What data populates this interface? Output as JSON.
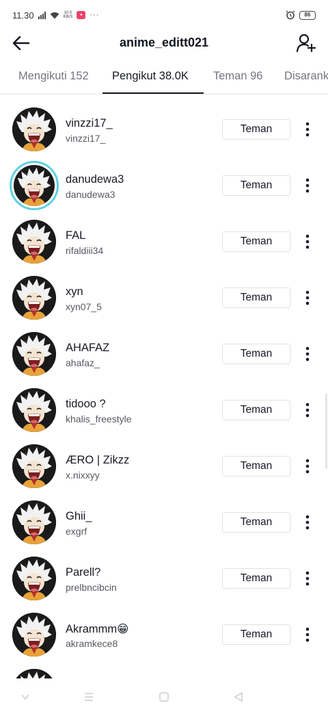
{
  "status_bar": {
    "time": "11.30",
    "net_speed_top": "10.0",
    "net_speed_bottom": "KB/S",
    "more": "···",
    "battery": "86"
  },
  "header": {
    "title": "anime_editt021",
    "back_icon": "arrow-left-icon",
    "add_icon": "add-user-icon"
  },
  "tabs": [
    {
      "label": "Mengikuti 152",
      "active": false
    },
    {
      "label": "Pengikut 38.0K",
      "active": true
    },
    {
      "label": "Teman 96",
      "active": false
    },
    {
      "label": "Disarankan",
      "active": false
    }
  ],
  "users": [
    {
      "name": "vinzzi17_",
      "username": "vinzzi17_",
      "button": "Teman",
      "story": false
    },
    {
      "name": "danudewa3",
      "username": "danudewa3",
      "button": "Teman",
      "story": true
    },
    {
      "name": "FAL",
      "username": "rifaldiii34",
      "button": "Teman",
      "story": false
    },
    {
      "name": "xyn",
      "username": "xyn07_5",
      "button": "Teman",
      "story": false
    },
    {
      "name": "AHAFAZ",
      "username": "ahafaz_",
      "button": "Teman",
      "story": false
    },
    {
      "name": "tidooo ?",
      "username": "khalis_freestyle",
      "button": "Teman",
      "story": false
    },
    {
      "name": "ÆRO | Zikzz",
      "username": "x.nixxyy",
      "button": "Teman",
      "story": false
    },
    {
      "name": "Ghii_",
      "username": "exgrf",
      "button": "Teman",
      "story": false
    },
    {
      "name": "Parell?",
      "username": "prelbncibcin",
      "button": "Teman",
      "story": false
    },
    {
      "name": "Akrammm😁",
      "username": "akramkece8",
      "button": "Teman",
      "story": false
    },
    {
      "name": "",
      "username": "",
      "button": "",
      "story": false
    }
  ],
  "system_nav": [
    "chevron-down-icon",
    "menu-icon",
    "home-square-icon",
    "back-triangle-icon"
  ],
  "colors": {
    "story_ring": "#5ed1e0",
    "active_tab": "#161823",
    "inactive_tab": "#75767e",
    "record_badge": "#e8456b"
  }
}
